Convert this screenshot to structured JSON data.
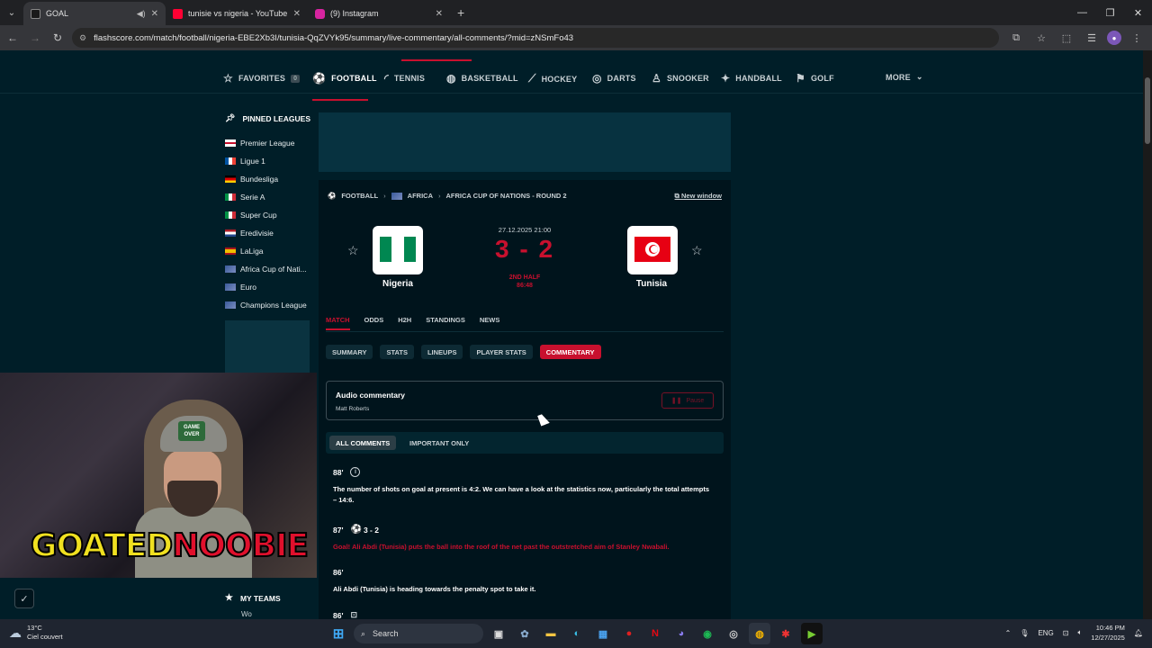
{
  "browser": {
    "tabs": [
      {
        "title": "GOAL",
        "active": true,
        "favicon_color": "#1a1a1a"
      },
      {
        "title": "tunisie vs nigeria - YouTube",
        "active": false,
        "favicon_color": "#ff0033"
      },
      {
        "title": "(9) Instagram",
        "active": false,
        "favicon_color": "#d6249f"
      }
    ],
    "url": "flashscore.com/match/football/nigeria-EBE2Xb3I/tunisia-QqZVYk95/summary/live-commentary/all-comments/?mid=zNSmFo43"
  },
  "sports_nav": {
    "items": [
      {
        "label": "FAVORITES",
        "icon": "star-icon",
        "badge": "0"
      },
      {
        "label": "FOOTBALL",
        "icon": "football-icon",
        "active": true
      },
      {
        "label": "TENNIS",
        "icon": "tennis-icon"
      },
      {
        "label": "BASKETBALL",
        "icon": "basketball-icon"
      },
      {
        "label": "HOCKEY",
        "icon": "hockey-icon"
      },
      {
        "label": "DARTS",
        "icon": "darts-icon"
      },
      {
        "label": "SNOOKER",
        "icon": "snooker-icon"
      },
      {
        "label": "HANDBALL",
        "icon": "handball-icon"
      },
      {
        "label": "GOLF",
        "icon": "golf-icon"
      }
    ],
    "more": "MORE"
  },
  "sidebar": {
    "pinned_title": "PINNED LEAGUES",
    "leagues": [
      {
        "label": "Premier League",
        "flag": "england"
      },
      {
        "label": "Ligue 1",
        "flag": "france"
      },
      {
        "label": "Bundesliga",
        "flag": "germany"
      },
      {
        "label": "Serie A",
        "flag": "italy"
      },
      {
        "label": "Super Cup",
        "flag": "italy"
      },
      {
        "label": "Eredivisie",
        "flag": "netherlands"
      },
      {
        "label": "LaLiga",
        "flag": "spain"
      },
      {
        "label": "Africa Cup of Nati...",
        "flag": "world"
      },
      {
        "label": "Euro",
        "flag": "world"
      },
      {
        "label": "Champions League",
        "flag": "world"
      }
    ],
    "partial_item": "Wo",
    "my_teams": "MY TEAMS"
  },
  "match": {
    "breadcrumb": [
      "FOOTBALL",
      "AFRICA",
      "AFRICA CUP OF NATIONS - ROUND 2"
    ],
    "new_window": "New window",
    "home": {
      "name": "Nigeria"
    },
    "away": {
      "name": "Tunisia"
    },
    "datetime": "27.12.2025 21:00",
    "score": "3 - 2",
    "phase": "2ND HALF",
    "clock": "86:48",
    "tabs": [
      "MATCH",
      "ODDS",
      "H2H",
      "STANDINGS",
      "NEWS"
    ],
    "subtabs": [
      "SUMMARY",
      "STATS",
      "LINEUPS",
      "PLAYER STATS",
      "COMMENTARY"
    ],
    "audio": {
      "title": "Audio commentary",
      "author": "Matt Roberts",
      "button": "Pause"
    },
    "filters": [
      "ALL COMMENTS",
      "IMPORTANT ONLY"
    ],
    "comments": [
      {
        "minute": "88'",
        "extra": "",
        "text": "The number of shots on goal at present is 4:2. We can have a look at the statistics now, particularly the total attempts – 14:6.",
        "goal": false
      },
      {
        "minute": "87'",
        "extra": "3 - 2",
        "text": "Goal! Ali Abdi (Tunisia) puts the ball into the roof of the net past the outstretched aim of Stanley Nwabali.",
        "goal": true
      },
      {
        "minute": "86'",
        "extra": "",
        "text": "Ali Abdi (Tunisia) is heading towards the penalty spot to take it.",
        "goal": false
      },
      {
        "minute": "86'",
        "extra": "",
        "text": "",
        "goal": false
      }
    ]
  },
  "overlay": {
    "brand_a": "GOATED",
    "brand_b": "NOOBIE",
    "cap_text": "GAME OVER"
  },
  "taskbar": {
    "temp": "13°C",
    "weather": "Ciel couvert",
    "search": "Search",
    "lang": "ENG",
    "time": "10:46 PM",
    "date": "12/27/2025"
  },
  "colors": {
    "accent": "#c8102e",
    "background": "#001e28"
  }
}
